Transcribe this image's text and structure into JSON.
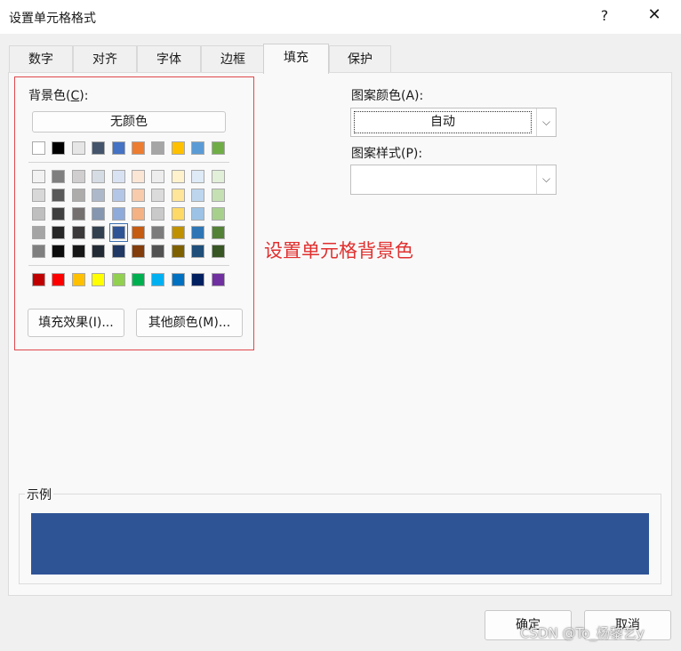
{
  "window": {
    "title": "设置单元格格式",
    "help": "?",
    "close": "✕"
  },
  "tabs": [
    {
      "label": "数字"
    },
    {
      "label": "对齐"
    },
    {
      "label": "字体"
    },
    {
      "label": "边框"
    },
    {
      "label": "填充",
      "active": true
    },
    {
      "label": "保护"
    }
  ],
  "background": {
    "label_text": "背景色(",
    "label_key": "C",
    "label_suffix": "):",
    "no_color": "无颜色",
    "theme_row": [
      "#ffffff",
      "#000000",
      "#e7e6e6",
      "#44546a",
      "#4472c4",
      "#ed7d31",
      "#a5a5a5",
      "#ffc000",
      "#5b9bd5",
      "#70ad47"
    ],
    "shade_rows": [
      [
        "#f2f2f2",
        "#7f7f7f",
        "#d0cece",
        "#d6dce4",
        "#d9e2f3",
        "#fbe5d5",
        "#ededed",
        "#fff2cc",
        "#deeaf6",
        "#e2efd9"
      ],
      [
        "#d8d8d8",
        "#595959",
        "#aeabab",
        "#adb9ca",
        "#b4c6e7",
        "#f7cbac",
        "#dbdbdb",
        "#fee599",
        "#bdd6ee",
        "#c5e0b3"
      ],
      [
        "#bfbfbf",
        "#3f3f3f",
        "#757070",
        "#8496b0",
        "#8eaadb",
        "#f4b183",
        "#c9c9c9",
        "#ffd965",
        "#9cc3e5",
        "#a8d08d"
      ],
      [
        "#a5a5a5",
        "#262626",
        "#3a3838",
        "#323f4f",
        "#2f5496",
        "#c55a11",
        "#7b7b7b",
        "#bf9000",
        "#2e75b5",
        "#538135"
      ],
      [
        "#7f7f7f",
        "#0c0c0c",
        "#171616",
        "#222a35",
        "#1f3864",
        "#833c0b",
        "#525252",
        "#7f6000",
        "#1e4e79",
        "#375623"
      ]
    ],
    "selected": "#2f5496",
    "standard_row": [
      "#c00000",
      "#ff0000",
      "#ffc000",
      "#ffff00",
      "#92d050",
      "#00b050",
      "#00b0f0",
      "#0070c0",
      "#002060",
      "#7030a0"
    ],
    "fill_effects": "填充效果(I)...",
    "more_colors": "其他颜色(M)..."
  },
  "pattern": {
    "color_label": "图案颜色(A):",
    "color_value": "自动",
    "style_label": "图案样式(P):",
    "style_value": ""
  },
  "annotation": {
    "text": "设置单元格背景色",
    "color": "#e0302f"
  },
  "sample": {
    "label": "示例",
    "fill_color": "#2f5496"
  },
  "footer": {
    "ok": "确定",
    "cancel": "取消"
  },
  "watermark": "CSDN @To_杨黎艺y"
}
